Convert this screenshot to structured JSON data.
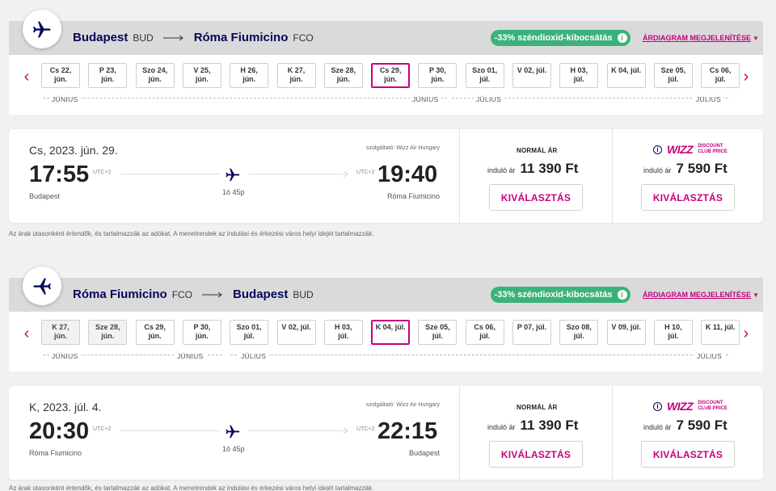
{
  "outbound": {
    "from_city": "Budapest",
    "from_code": "BUD",
    "to_city": "Róma Fiumicino",
    "to_code": "FCO",
    "co2_label": "-33% széndioxid-kibocsátás",
    "price_chart_link": "ÁRDIAGRAM MEGJELENÍTÉSE",
    "dates": [
      {
        "l1": "Cs 22,",
        "l2": "jún."
      },
      {
        "l1": "P 23,",
        "l2": "jún."
      },
      {
        "l1": "Szo 24,",
        "l2": "jún."
      },
      {
        "l1": "V 25,",
        "l2": "jún."
      },
      {
        "l1": "H 26,",
        "l2": "jún."
      },
      {
        "l1": "K 27,",
        "l2": "jún."
      },
      {
        "l1": "Sze 28,",
        "l2": "jún."
      },
      {
        "l1": "Cs 29,",
        "l2": "jún."
      },
      {
        "l1": "P 30,",
        "l2": "jún."
      },
      {
        "l1": "Szo 01,",
        "l2": "júl."
      },
      {
        "l1": "V 02, júl.",
        "l2": ""
      },
      {
        "l1": "H 03,",
        "l2": "júl."
      },
      {
        "l1": "K 04, júl.",
        "l2": ""
      },
      {
        "l1": "Sze 05,",
        "l2": "júl."
      },
      {
        "l1": "Cs 06,",
        "l2": "júl."
      }
    ],
    "months": [
      "JÚNIUS",
      "JÚNIUS",
      "JÚLIUS",
      "JÚLIUS"
    ],
    "date_label": "Cs, 2023. jún. 29.",
    "operator": "szolgáltató: Wizz Air Hungary",
    "dep_time": "17:55",
    "dep_tz": "UTC+2",
    "dep_city": "Budapest",
    "arr_time": "19:40",
    "arr_tz": "UTC+2",
    "arr_city": "Róma Fiumicino",
    "duration": "1ó 45p",
    "normal_title": "NORMÁL ÁR",
    "from_label": "induló ár",
    "normal_price": "11 390 Ft",
    "club_from_label": "induló ár",
    "club_price": "7 590 Ft",
    "select_label": "KIVÁLASZTÁS",
    "select_label_club": "KIVÁLASZTÁS"
  },
  "inbound": {
    "from_city": "Róma Fiumicino",
    "from_code": "FCO",
    "to_city": "Budapest",
    "to_code": "BUD",
    "co2_label": "-33% széndioxid-kibocsátás",
    "price_chart_link": "ÁRDIAGRAM MEGJELENÍTÉSE",
    "dates": [
      {
        "l1": "K 27,",
        "l2": "jún."
      },
      {
        "l1": "Sze 28,",
        "l2": "jún."
      },
      {
        "l1": "Cs 29,",
        "l2": "jún."
      },
      {
        "l1": "P 30,",
        "l2": "jún."
      },
      {
        "l1": "Szo 01,",
        "l2": "júl."
      },
      {
        "l1": "V 02, júl.",
        "l2": ""
      },
      {
        "l1": "H 03,",
        "l2": "júl."
      },
      {
        "l1": "K 04, júl.",
        "l2": ""
      },
      {
        "l1": "Sze 05,",
        "l2": "júl."
      },
      {
        "l1": "Cs 06,",
        "l2": "júl."
      },
      {
        "l1": "P 07, júl.",
        "l2": ""
      },
      {
        "l1": "Szo 08,",
        "l2": "júl."
      },
      {
        "l1": "V 09, júl.",
        "l2": ""
      },
      {
        "l1": "H 10,",
        "l2": "júl."
      },
      {
        "l1": "K 11, júl.",
        "l2": ""
      }
    ],
    "months": [
      "JÚNIUS",
      "JÚNIUS",
      "JÚLIUS",
      "JÚLIUS"
    ],
    "date_label": "K, 2023. júl. 4.",
    "operator": "szolgáltató: Wizz Air Hungary",
    "dep_time": "20:30",
    "dep_tz": "UTC+2",
    "dep_city": "Róma Fiumicino",
    "arr_time": "22:15",
    "arr_tz": "UTC+2",
    "arr_city": "Budapest",
    "duration": "1ó 45p",
    "normal_title": "NORMÁL ÁR",
    "from_label": "induló ár",
    "normal_price": "11 390 Ft",
    "club_from_label": "induló ár",
    "club_price": "7 590 Ft",
    "select_label": "KIVÁLASZTÁS",
    "select_label_club": "KIVÁLASZTÁS"
  },
  "club": {
    "brand": "WIZZ",
    "line1": "DISCOUNT",
    "line2": "CLUB PRICE"
  },
  "disclaimer": "Az árak utasonként értendők, és tartalmazzák az adókat. A menetrendek az indulási és érkezési város helyi idejét tartalmazzák.",
  "disclaimer2": "Az árak utasonként értendők, és tartalmazzák az adókat. A menetrendek az indulási és érkezési város helyi idejét tartalmazzák.",
  "colors": {
    "brand_navy": "#06065e",
    "brand_pink": "#c6007e",
    "co2_green": "#3ab27a"
  }
}
